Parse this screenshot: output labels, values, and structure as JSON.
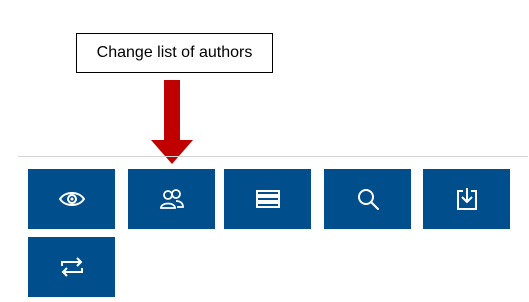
{
  "callout": {
    "text": "Change list of authors"
  },
  "colors": {
    "tile_background": "#004e8c",
    "icon": "#ffffff",
    "arrow": "#c00000",
    "divider": "#d4d4d4"
  },
  "toolbar": {
    "buttons": [
      {
        "icon": "eye-icon"
      },
      {
        "icon": "people-icon"
      },
      {
        "icon": "list-icon"
      },
      {
        "icon": "search-icon"
      },
      {
        "icon": "download-icon"
      },
      {
        "icon": "swap-arrows-icon"
      }
    ]
  }
}
